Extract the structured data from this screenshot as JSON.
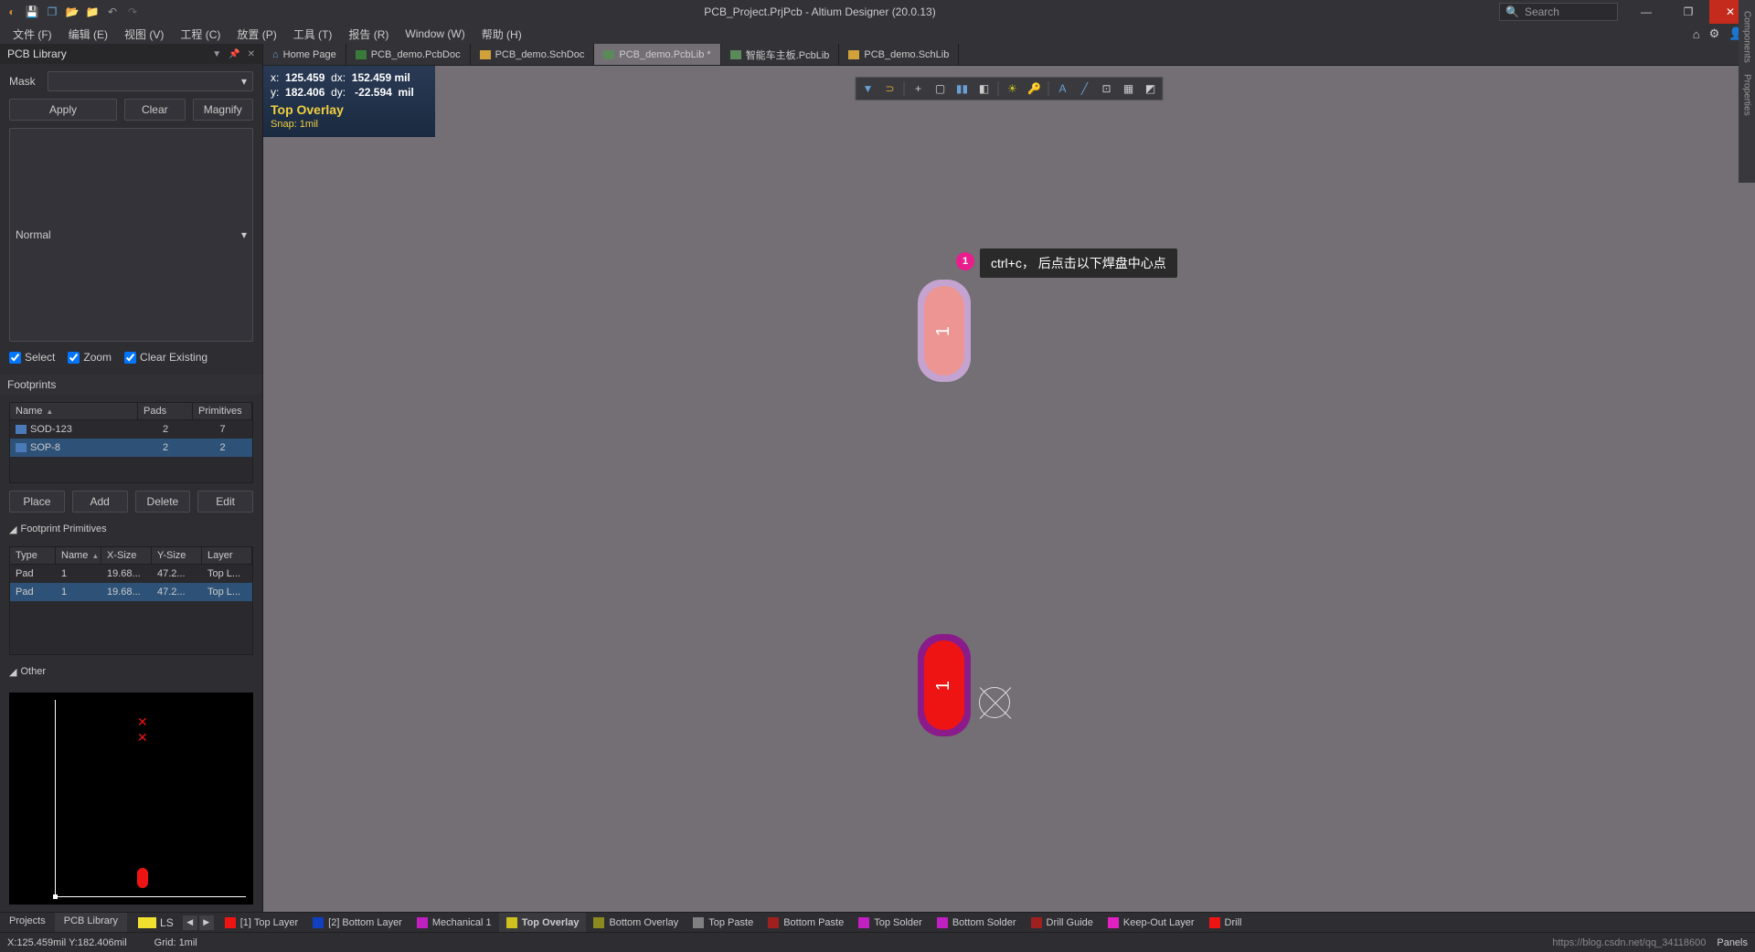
{
  "titlebar": {
    "title": "PCB_Project.PrjPcb - Altium Designer (20.0.13)",
    "search_placeholder": "Search"
  },
  "menu": {
    "items": [
      "文件 (F)",
      "编辑 (E)",
      "视图 (V)",
      "工程 (C)",
      "放置 (P)",
      "工具 (T)",
      "报告 (R)",
      "Window (W)",
      "帮助 (H)"
    ]
  },
  "left_panel": {
    "title": "PCB Library",
    "mask_label": "Mask",
    "apply": "Apply",
    "clear": "Clear",
    "magnify": "Magnify",
    "normal": "Normal",
    "chk_select": "Select",
    "chk_zoom": "Zoom",
    "chk_clear_existing": "Clear Existing",
    "footprints_title": "Footprints",
    "fp_headers": {
      "name": "Name",
      "pads": "Pads",
      "primitives": "Primitives"
    },
    "fp_rows": [
      {
        "name": "SOD-123",
        "pads": "2",
        "primitives": "7"
      },
      {
        "name": "SOP-8",
        "pads": "2",
        "primitives": "2"
      }
    ],
    "place": "Place",
    "add": "Add",
    "delete": "Delete",
    "edit": "Edit",
    "primitives_title": "Footprint Primitives",
    "pp_headers": {
      "type": "Type",
      "name": "Name",
      "xsize": "X-Size",
      "ysize": "Y-Size",
      "layer": "Layer"
    },
    "pp_rows": [
      {
        "type": "Pad",
        "name": "1",
        "xsize": "19.68...",
        "ysize": "47.2...",
        "layer": "Top L..."
      },
      {
        "type": "Pad",
        "name": "1",
        "xsize": "19.68...",
        "ysize": "47.2...",
        "layer": "Top L..."
      }
    ],
    "other_title": "Other"
  },
  "doc_tabs": [
    {
      "label": "Home Page",
      "icon": "home-icon"
    },
    {
      "label": "PCB_demo.PcbDoc",
      "icon": "pcb-icon"
    },
    {
      "label": "PCB_demo.SchDoc",
      "icon": "sch-icon"
    },
    {
      "label": "PCB_demo.PcbLib *",
      "icon": "pcblib-icon",
      "active": true
    },
    {
      "label": "智能车主板.PcbLib",
      "icon": "pcblib-icon"
    },
    {
      "label": "PCB_demo.SchLib",
      "icon": "schlib-icon"
    }
  ],
  "hud": {
    "x_lbl": "x:",
    "x": "125.459",
    "dx_lbl": "dx:",
    "dx": "152.459",
    "unit": "mil",
    "y_lbl": "y:",
    "y": "182.406",
    "dy_lbl": "dy:",
    "dy": "-22.594",
    "layer": "Top Overlay",
    "snap": "Snap: 1mil"
  },
  "callout": {
    "num": "1",
    "text": "ctrl+c， 后点击以下焊盘中心点"
  },
  "pad_num_1": "1",
  "pad_num_2": "1",
  "right_panels": {
    "components": "Components",
    "properties": "Properties"
  },
  "bottom_tabs": {
    "projects": "Projects",
    "pcb_library": "PCB Library"
  },
  "layer_bar": {
    "ls": "LS",
    "items": [
      {
        "label": "[1] Top Layer",
        "color": "#ef1414"
      },
      {
        "label": "[2] Bottom Layer",
        "color": "#1040c0"
      },
      {
        "label": "Mechanical 1",
        "color": "#c020c0"
      },
      {
        "label": "Top Overlay",
        "color": "#d0c020",
        "active": true
      },
      {
        "label": "Bottom Overlay",
        "color": "#8a8a20"
      },
      {
        "label": "Top Paste",
        "color": "#808080"
      },
      {
        "label": "Bottom Paste",
        "color": "#a02020"
      },
      {
        "label": "Top Solder",
        "color": "#c020c0"
      },
      {
        "label": "Bottom Solder",
        "color": "#c020c0"
      },
      {
        "label": "Drill Guide",
        "color": "#a02020"
      },
      {
        "label": "Keep-Out Layer",
        "color": "#e020c0"
      },
      {
        "label": "Drill",
        "color": "#ef1414"
      }
    ]
  },
  "statusbar": {
    "pos": "X:125.459mil Y:182.406mil",
    "grid": "Grid: 1mil",
    "watermark": "https://blog.csdn.net/qq_34118600",
    "panels": "Panels"
  }
}
